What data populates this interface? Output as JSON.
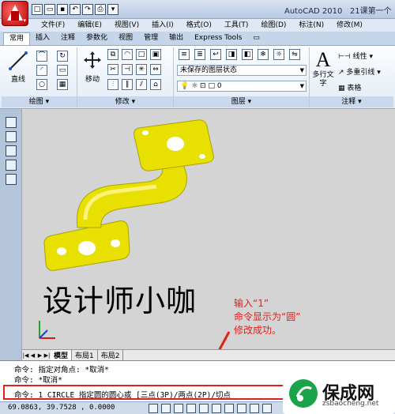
{
  "app": {
    "title": "AutoCAD 2010",
    "file_title": "21课第一个"
  },
  "menubar": [
    "文件(F)",
    "编辑(E)",
    "视图(V)",
    "插入(I)",
    "格式(O)",
    "工具(T)",
    "绘图(D)",
    "标注(N)",
    "修改(M)"
  ],
  "ribbon_tabs": [
    "常用",
    "插入",
    "注释",
    "参数化",
    "视图",
    "管理",
    "输出",
    "Express Tools"
  ],
  "ribbon": {
    "draw": {
      "line_label": "直线",
      "title": "绘图"
    },
    "modify": {
      "move_label": "移动",
      "title": "修改"
    },
    "layers": {
      "state": "未保存的图层状态",
      "current_layer": "0",
      "title": "图层"
    },
    "annotation": {
      "text_label": "多行文字",
      "linear_label": "线性",
      "multileader_label": "多重引线",
      "table_label": "表格",
      "title": "注释"
    }
  },
  "viewport": {
    "overlay_text": "设计师小咖",
    "annotation_lines": [
      "输入“1”",
      "命令显示为“圆”",
      "修改成功。"
    ]
  },
  "layout_tabs": [
    "模型",
    "布局1",
    "布局2"
  ],
  "command": {
    "history": [
      "命令: 指定对角点: *取消*",
      "命令: *取消*"
    ],
    "current": "命令: 1 CIRCLE 指定圆的圆心或 [三点(3P)/两点(2P)/切点"
  },
  "status": {
    "coordinates": "69.0863,   39.7528 , 0.0000"
  },
  "watermark": {
    "brand": "保成网",
    "url": "zsbaocheng.net"
  },
  "colors": {
    "viewport_bg": "#d4d4d4",
    "object_yellow": "#e8e000",
    "highlight_red": "#e0201b"
  }
}
